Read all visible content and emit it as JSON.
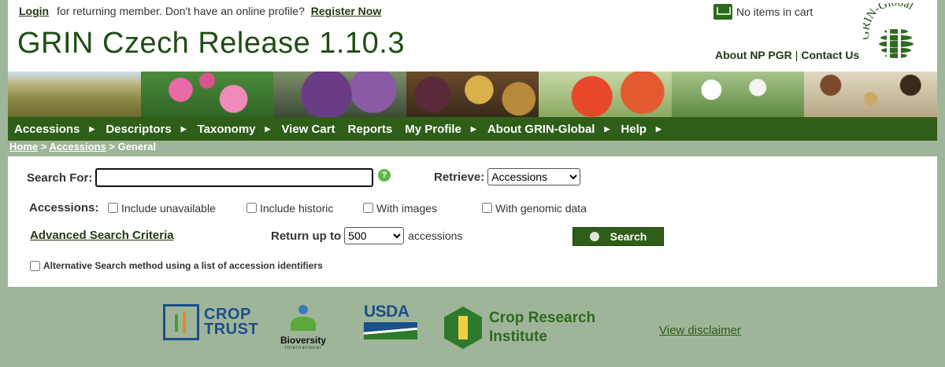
{
  "header": {
    "login_link": "Login",
    "login_text": "for returning member. Don't have an online profile?",
    "register_link": "Register Now",
    "title": "GRIN Czech Release 1.10.3",
    "cart_text": "No items in cart",
    "about_link": "About NP PGR",
    "separator": "|",
    "contact_link": "Contact Us",
    "logo_text": "GRIN-Global"
  },
  "nav": {
    "items": [
      {
        "label": "Accessions"
      },
      {
        "label": "Descriptors"
      },
      {
        "label": "Taxonomy"
      },
      {
        "label": "View Cart"
      },
      {
        "label": "Reports"
      },
      {
        "label": "My Profile"
      },
      {
        "label": "About GRIN-Global"
      },
      {
        "label": "Help"
      }
    ]
  },
  "breadcrumb": {
    "home": "Home",
    "sep1": ">",
    "accessions": "Accessions",
    "sep2": ">",
    "current": "General"
  },
  "search": {
    "search_for_label": "Search For:",
    "query_value": "",
    "help_icon": "?",
    "retrieve_label": "Retrieve:",
    "retrieve_selected": "Accessions",
    "accessions_label": "Accessions:",
    "checkboxes": {
      "include_unavailable": "Include unavailable",
      "include_historic": "Include historic",
      "with_images": "With images",
      "with_genomic_data": "With genomic data"
    },
    "advanced_link": "Advanced Search Criteria",
    "return_label": "Return up to",
    "return_selected": "500",
    "return_unit": "accessions",
    "search_button": "Search",
    "alt_method": "Alternative Search method using a list of accession identifiers"
  },
  "footer": {
    "crop_trust_line1": "CROP",
    "crop_trust_line2": "TRUST",
    "bioversity": "Bioversity",
    "bioversity_sub": "International",
    "usda": "USDA",
    "cri_line1": "Crop Research",
    "cri_line2": "Institute",
    "disclaimer": "View disclaimer"
  },
  "colors": {
    "nav_green": "#2e5e17",
    "page_bg": "#9fb59a",
    "title_green": "#1f4d14"
  }
}
